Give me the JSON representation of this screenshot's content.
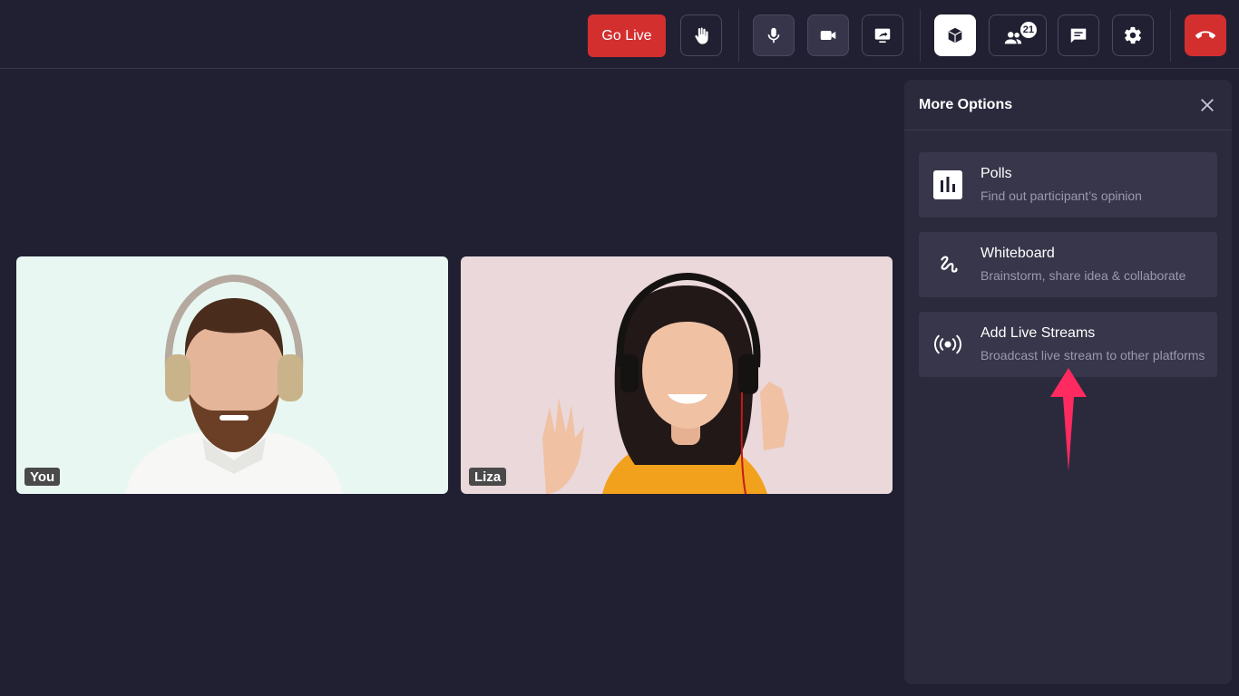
{
  "toolbar": {
    "go_live_label": "Go Live",
    "participants_count": "21",
    "icons": [
      "raise-hand-icon",
      "mic-icon",
      "video-camera-icon",
      "screen-share-icon",
      "more-options-icon",
      "participants-icon",
      "chat-icon",
      "settings-icon",
      "end-call-icon"
    ],
    "colors": {
      "go_live": "#d32f2f",
      "end_call": "#d32f2f",
      "active": "#ffffff"
    }
  },
  "tiles": [
    {
      "name": "You",
      "background": "#e8f7f1"
    },
    {
      "name": "Liza",
      "background": "#ead8db"
    }
  ],
  "panel": {
    "title": "More Options",
    "options": [
      {
        "title": "Polls",
        "description": "Find out participant’s opinion",
        "icon": "poll-chart-icon"
      },
      {
        "title": "Whiteboard",
        "description": "Brainstorm, share idea & collaborate",
        "icon": "whiteboard-squiggle-icon"
      },
      {
        "title": "Add Live Streams",
        "description": "Broadcast live stream to other platforms",
        "icon": "broadcast-icon"
      }
    ]
  },
  "annotation": {
    "color": "#ff2a5f"
  }
}
